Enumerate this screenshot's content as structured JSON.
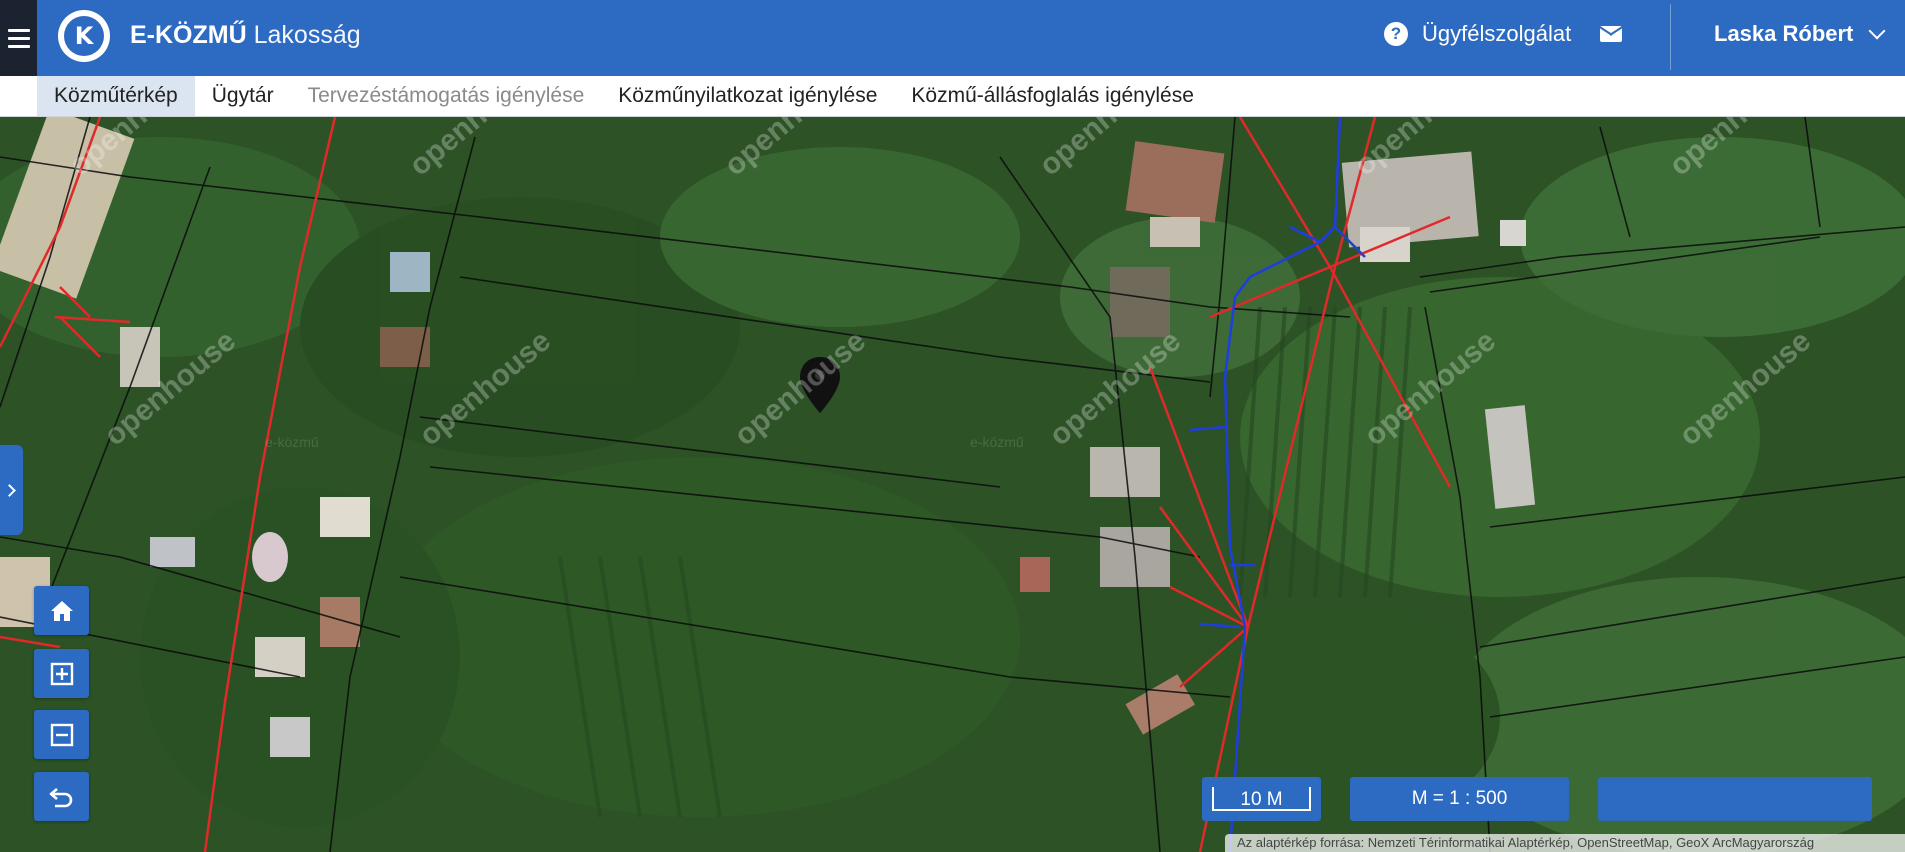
{
  "header": {
    "logo_letter": "K",
    "brand_bold": "E-KÖZMŰ",
    "brand_light": "Lakosság",
    "help_label": "Ügyfélszolgálat",
    "user_name": "Laska Róbert"
  },
  "tabs": [
    {
      "label": "Közműtérkép",
      "active": true,
      "disabled": false
    },
    {
      "label": "Ügytár",
      "active": false,
      "disabled": false
    },
    {
      "label": "Tervezéstámogatás igénylése",
      "active": false,
      "disabled": true
    },
    {
      "label": "Közműnyilatkozat igénylése",
      "active": false,
      "disabled": false
    },
    {
      "label": "Közmű-állásfoglalás igénylése",
      "active": false,
      "disabled": false
    }
  ],
  "map": {
    "watermark_text": "openhouse",
    "faint_watermark": "e-közmű",
    "scale_bar_label": "10 M",
    "scale_ratio": "M = 1 : 500",
    "coordinate_box": "",
    "attribution": "Az alaptérkép forrása: Nemzeti Térinformatikai Alaptérkép, OpenStreetMap, GeoX ArcMagyarország"
  },
  "controls": [
    "home-icon",
    "zoom-in-icon",
    "zoom-out-icon",
    "undo-icon"
  ],
  "colors": {
    "primary": "#2d6ac2",
    "hamburger_bg": "#1c2330",
    "active_tab_bg": "#dbe5f1",
    "electric_line": "#e02a2a",
    "water_line": "#1f3ee0"
  }
}
